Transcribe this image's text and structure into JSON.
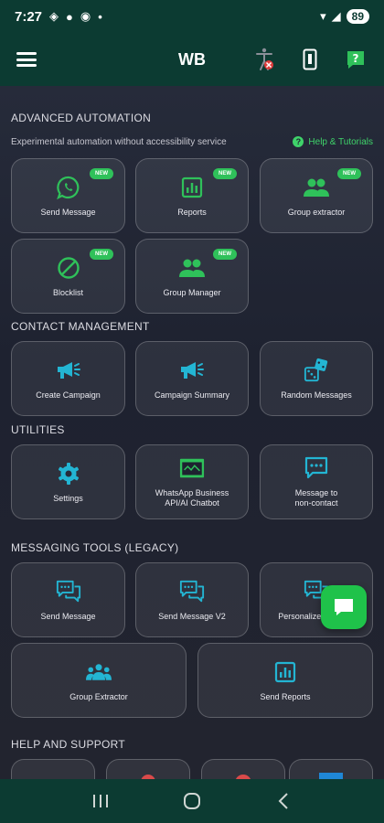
{
  "status_bar": {
    "time": "7:27",
    "battery": "89"
  },
  "app_bar": {
    "title": "WB",
    "icons": [
      "menu-icon",
      "accessibility-off-icon",
      "phone-icon",
      "help-icon"
    ]
  },
  "sections": {
    "advanced": {
      "title": "ADVANCED AUTOMATION",
      "subtitle": "Experimental automation without accessibility service",
      "help_link": "Help & Tutorials",
      "help_glyph": "?",
      "cards": [
        {
          "label": "Send Message",
          "badge": "NEW",
          "icon": "whatsapp-icon"
        },
        {
          "label": "Reports",
          "badge": "NEW",
          "icon": "report-icon"
        },
        {
          "label": "Group extractor",
          "badge": "NEW",
          "icon": "group-icon"
        },
        {
          "label": "Blocklist",
          "badge": "NEW",
          "icon": "block-icon"
        },
        {
          "label": "Group Manager",
          "badge": "NEW",
          "icon": "group-icon"
        }
      ]
    },
    "contact": {
      "title": "CONTACT MANAGEMENT",
      "cards": [
        {
          "label": "Create Campaign",
          "icon": "megaphone-icon"
        },
        {
          "label": "Campaign Summary",
          "icon": "megaphone-icon"
        },
        {
          "label": "Random Messages",
          "icon": "dice-icon"
        }
      ]
    },
    "utilities": {
      "title": "UTILITIES",
      "cards": [
        {
          "label": "Settings",
          "icon": "gear-icon"
        },
        {
          "label": "WhatsApp Business API/AI Chatbot",
          "line1": "WhatsApp Business",
          "line2": "API/AI Chatbot",
          "icon": "api-chatbot-icon"
        },
        {
          "label": "Message to non-contact",
          "line1": "Message to",
          "line2": "non-contact",
          "icon": "chat-icon"
        }
      ]
    },
    "legacy": {
      "title": "MESSAGING TOOLS (LEGACY)",
      "cards": [
        {
          "label": "Send Message",
          "icon": "chat-bubbles-icon"
        },
        {
          "label": "Send Message V2",
          "icon": "chat-bubbles-icon"
        },
        {
          "label": "Personalized Sender",
          "icon": "chat-bubbles-icon"
        },
        {
          "label": "Group Extractor",
          "icon": "group-icon"
        },
        {
          "label": "Send Reports",
          "icon": "report-icon"
        }
      ]
    },
    "help": {
      "title": "HELP AND SUPPORT"
    }
  },
  "colors": {
    "primary_dark": "#0c3b32",
    "accent_green": "#2fc15a",
    "icon_teal": "#23b5d3",
    "icon_green": "#2fc15a",
    "card_border": "#55596a"
  }
}
